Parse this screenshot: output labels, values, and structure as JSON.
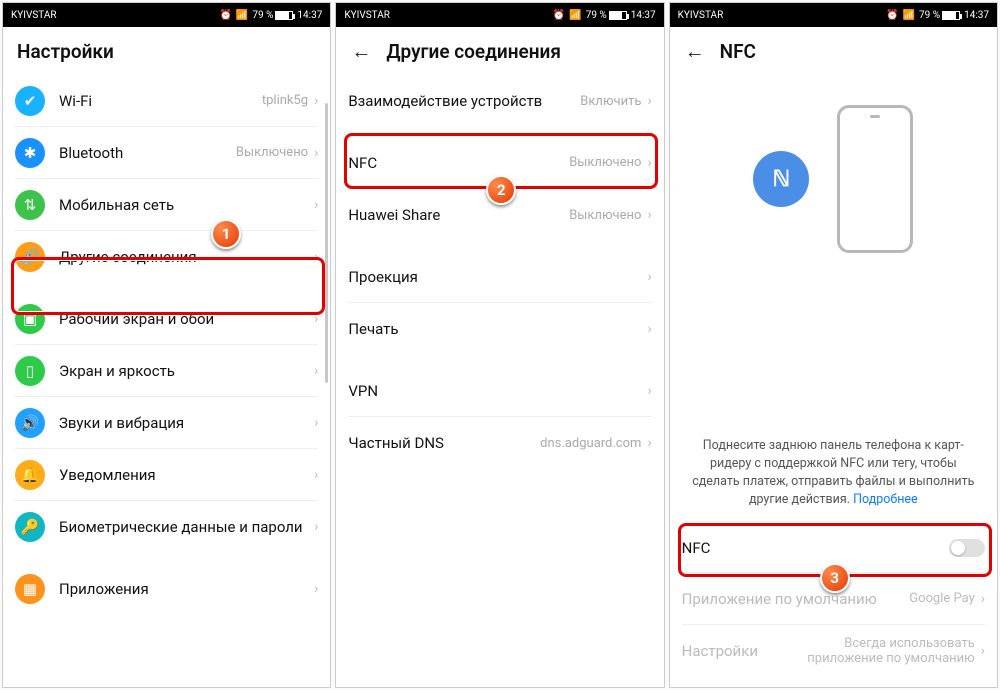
{
  "statusbar": {
    "carrier": "KYIVSTAR",
    "battery": "79 %",
    "time": "14:37"
  },
  "screen1": {
    "title": "Настройки",
    "items": [
      {
        "icon": "wifi",
        "label": "Wi-Fi",
        "val": "tplink5g"
      },
      {
        "icon": "bt",
        "label": "Bluetooth",
        "val": "Выключено"
      },
      {
        "icon": "mob",
        "label": "Мобильная сеть",
        "val": ""
      },
      {
        "icon": "other",
        "label": "Другие соединения",
        "val": ""
      },
      {
        "icon": "home",
        "label": "Рабочий экран и обои",
        "val": ""
      },
      {
        "icon": "disp",
        "label": "Экран и яркость",
        "val": ""
      },
      {
        "icon": "snd",
        "label": "Звуки и вибрация",
        "val": ""
      },
      {
        "icon": "notif",
        "label": "Уведомления",
        "val": ""
      },
      {
        "icon": "bio",
        "label": "Биометрические данные и пароли",
        "val": ""
      },
      {
        "icon": "apps",
        "label": "Приложения",
        "val": ""
      }
    ],
    "badge": "1"
  },
  "screen2": {
    "title": "Другие соединения",
    "groups": [
      [
        {
          "label": "Взаимодействие устройств",
          "val": "Включить"
        }
      ],
      [
        {
          "label": "NFC",
          "val": "Выключено"
        },
        {
          "label": "Huawei Share",
          "val": "Выключено"
        }
      ],
      [
        {
          "label": "Проекция",
          "val": ""
        },
        {
          "label": "Печать",
          "val": ""
        }
      ],
      [
        {
          "label": "VPN",
          "val": ""
        },
        {
          "label": "Частный DNS",
          "val": "dns.adguard.com"
        }
      ]
    ],
    "badge": "2"
  },
  "screen3": {
    "title": "NFC",
    "desc_pre": "Поднесите заднюю панель телефона к карт-ридеру с поддержкой NFC или тегу, чтобы сделать платеж, отправить файлы и выполнить другие действия. ",
    "desc_link": "Подробнее",
    "toggle_label": "NFC",
    "row2_label": "Приложение по умолчанию",
    "row2_val": "Google Pay",
    "row3_label": "Настройки",
    "row3_val": "Всегда использовать приложение по умолчанию",
    "badge": "3"
  }
}
